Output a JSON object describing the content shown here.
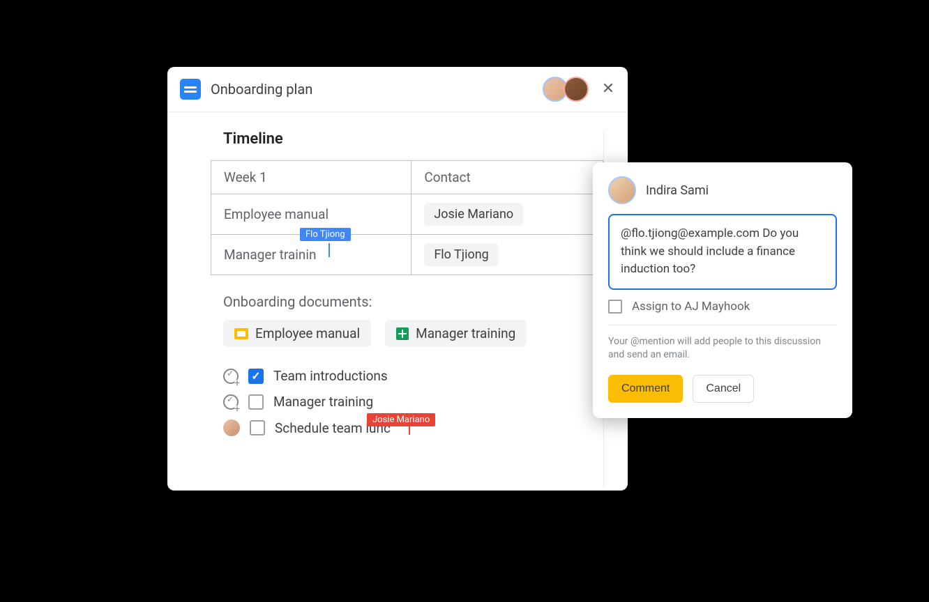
{
  "doc": {
    "title": "Onboarding plan",
    "section_title": "Timeline",
    "table": {
      "headers": [
        "Week 1",
        "Contact"
      ],
      "rows": [
        {
          "col1": "Employee manual",
          "contact": "Josie Mariano"
        },
        {
          "col1": "Manager trainin",
          "contact": "Flo Tjiong"
        }
      ]
    },
    "cursor_blue_label": "Flo Tjiong",
    "sub_title": "Onboarding documents:",
    "doc_chips": [
      {
        "icon": "slides",
        "label": "Employee manual"
      },
      {
        "icon": "sheets",
        "label": "Manager training"
      }
    ],
    "tasks": [
      {
        "side": "check-plus",
        "checked": true,
        "label": "Team introductions"
      },
      {
        "side": "check-plus",
        "checked": false,
        "label": "Manager training"
      },
      {
        "side": "avatar",
        "checked": false,
        "label": "Schedule team lunc"
      }
    ],
    "cursor_red_label": "Josie Mariano"
  },
  "comment": {
    "author": "Indira Sami",
    "text": "@flo.tjiong@example.com Do you think we should include a finance induction too?",
    "assign_label": "Assign to AJ Mayhook",
    "hint": "Your @mention will add people to this discussion and send an email.",
    "primary_btn": "Comment",
    "secondary_btn": "Cancel"
  }
}
